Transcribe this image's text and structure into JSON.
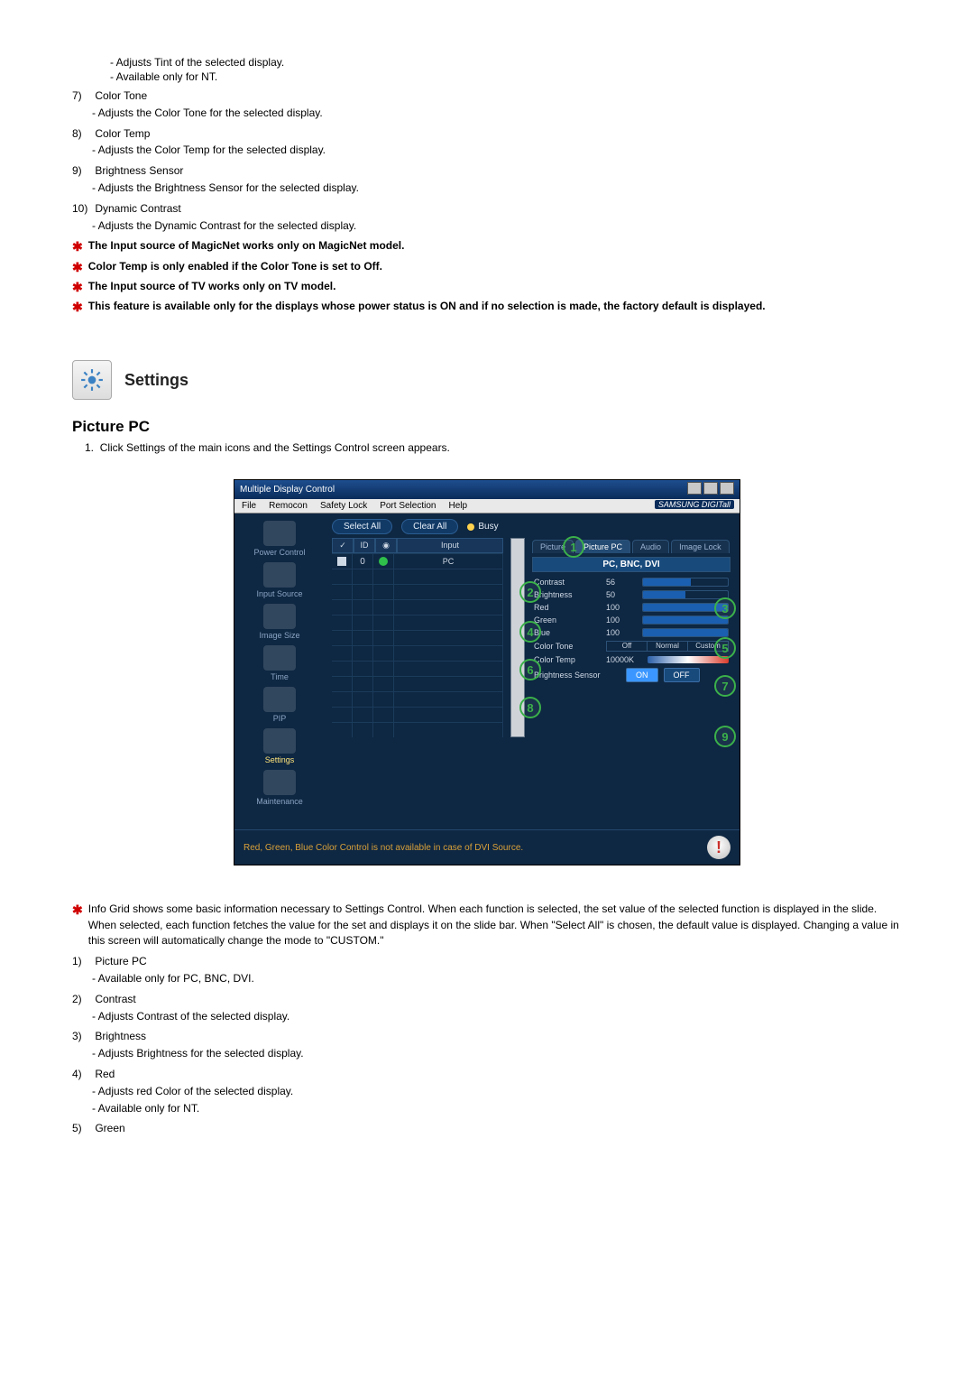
{
  "top_list": {
    "pre": [
      "- Adjusts Tint of the selected display.",
      "- Available  only for NT."
    ],
    "items": [
      {
        "num": "7)",
        "title": "Color Tone",
        "subs": [
          "- Adjusts the Color Tone for the selected display."
        ]
      },
      {
        "num": "8)",
        "title": "Color Temp",
        "subs": [
          "- Adjusts the Color Temp for the selected display."
        ]
      },
      {
        "num": "9)",
        "title": "Brightness Sensor",
        "subs": [
          "- Adjusts the Brightness Sensor for the selected display."
        ]
      },
      {
        "num": "10)",
        "title": "Dynamic Contrast",
        "subs": [
          "- Adjusts the Dynamic Contrast for the selected display."
        ]
      }
    ]
  },
  "stars_top": [
    "The Input source of MagicNet works only on MagicNet model.",
    "Color Temp is only enabled if the Color Tone is set to Off.",
    "The Input source of TV works only on TV model.",
    "This feature is available only for the displays whose power status is ON and if no selection is made, the factory default is displayed."
  ],
  "section": {
    "title": "Settings"
  },
  "subsection": {
    "title": "Picture PC"
  },
  "step1": "Click Settings of the main icons and the Settings Control screen appears.",
  "mock": {
    "title": "Multiple Display Control",
    "menu": [
      "File",
      "Remocon",
      "Safety Lock",
      "Port Selection",
      "Help"
    ],
    "brand": "SAMSUNG DIGITall",
    "select_all": "Select All",
    "clear_all": "Clear All",
    "busy": "Busy",
    "grid_headers": {
      "col_input": "Input"
    },
    "grid_row": {
      "id": "0",
      "input": "PC"
    },
    "side": [
      "Power Control",
      "Input Source",
      "Image Size",
      "Time",
      "PIP",
      "Settings",
      "Maintenance"
    ],
    "tabs": [
      "Picture",
      "Picture PC",
      "Audio",
      "Image Lock"
    ],
    "subbar": "PC, BNC, DVI",
    "rows": {
      "contrast": {
        "label": "Contrast",
        "val": "56"
      },
      "brightness": {
        "label": "Brightness",
        "val": "50"
      },
      "red": {
        "label": "Red",
        "val": "100"
      },
      "green": {
        "label": "Green",
        "val": "100"
      },
      "blue": {
        "label": "Blue",
        "val": "100"
      },
      "colortone": {
        "label": "Color Tone",
        "opts": [
          "Off",
          "Normal",
          "Custom"
        ]
      },
      "colortemp": {
        "label": "Color Temp",
        "val": "10000K"
      },
      "bsensor": {
        "label": "Brightness Sensor",
        "on": "ON",
        "off": "OFF"
      }
    },
    "warn": "Red, Green, Blue Color Control is not available in case of DVI Source."
  },
  "star_info": "Info Grid shows some basic information necessary to Settings Control. When each function is selected, the set value of the selected function is displayed in the slide. When selected, each function fetches the value for the set and displays it on the slide bar. When \"Select All\" is chosen, the default value is displayed. Changing a value in this screen will automatically change the mode to \"CUSTOM.\"",
  "bottom_list": [
    {
      "num": "1)",
      "title": "Picture PC",
      "subs": [
        "- Available only for PC, BNC, DVI."
      ]
    },
    {
      "num": "2)",
      "title": "Contrast",
      "subs": [
        "- Adjusts Contrast of the selected display."
      ]
    },
    {
      "num": "3)",
      "title": "Brightness",
      "subs": [
        "- Adjusts Brightness for the selected display."
      ]
    },
    {
      "num": "4)",
      "title": "Red",
      "subs": [
        "- Adjusts red Color of the selected display.",
        "- Available  only for NT."
      ]
    },
    {
      "num": "5)",
      "title": "Green"
    }
  ]
}
